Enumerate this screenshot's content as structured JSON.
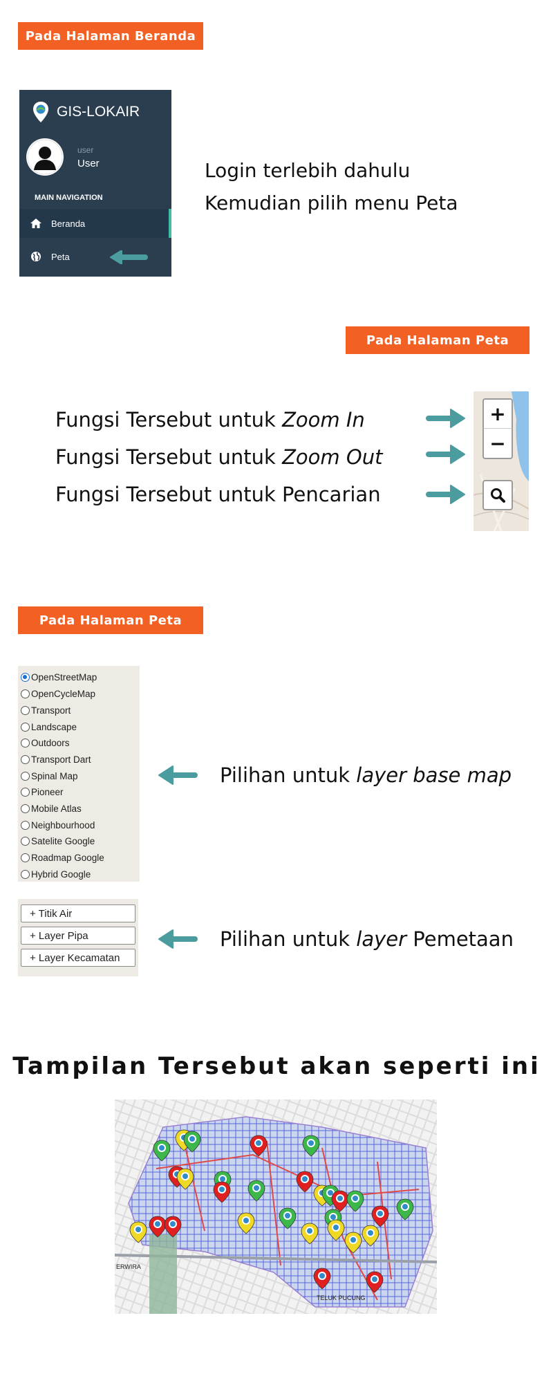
{
  "section1": {
    "tag": "Pada Halaman Beranda",
    "sidebar": {
      "brand": "GIS-LOKAIR",
      "user_small": "user",
      "user_name": "User",
      "nav_header": "MAIN NAVIGATION",
      "items": [
        {
          "label": "Beranda",
          "icon": "home-icon"
        },
        {
          "label": "Peta",
          "icon": "globe-icon"
        }
      ]
    },
    "instruction_line1": "Login terlebih dahulu",
    "instruction_line2": "Kemudian pilih menu Peta"
  },
  "section2": {
    "tag": "Pada Halaman Peta",
    "lines": [
      {
        "prefix": "Fungsi Tersebut untuk ",
        "emph": "Zoom In"
      },
      {
        "prefix": "Fungsi Tersebut untuk ",
        "emph": "Zoom Out"
      },
      {
        "prefix": "Fungsi Tersebut untuk Pencarian",
        "emph": ""
      }
    ],
    "controls": {
      "zoom_in": "+",
      "zoom_out": "−"
    }
  },
  "section3": {
    "tag": "Pada Halaman Peta",
    "basemaps": [
      "OpenStreetMap",
      "OpenCycleMap",
      "Transport",
      "Landscape",
      "Outdoors",
      "Transport Dart",
      "Spinal Map",
      "Pioneer",
      "Mobile Atlas",
      "Neighbourhood",
      "Satelite Google",
      "Roadmap Google",
      "Hybrid Google"
    ],
    "selected_basemap": "OpenStreetMap",
    "basemap_caption_prefix": "Pilihan untuk ",
    "basemap_caption_emph": "layer base map",
    "layers": [
      "+ Titik Air",
      "+ Layer Pipa",
      "+ Layer Kecamatan"
    ],
    "layer_caption_prefix": "Pilihan untuk ",
    "layer_caption_emph": "layer",
    "layer_caption_suffix": " Pemetaan"
  },
  "section4": {
    "title": "Tampilan Tersebut akan seperti ini",
    "map_labels": [
      "ERWIRA",
      "TELUK PUCUNG"
    ]
  },
  "colors": {
    "accent": "#f26024",
    "arrow": "#4a9c9e",
    "sidebar": "#2b3e50"
  }
}
